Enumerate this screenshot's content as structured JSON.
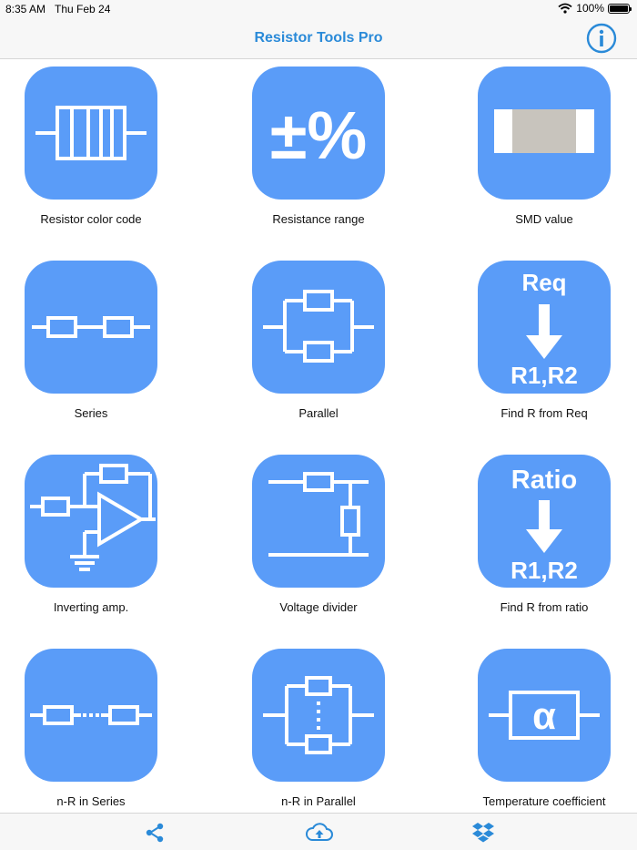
{
  "status": {
    "time": "8:35 AM",
    "date": "Thu Feb 24",
    "battery": "100%"
  },
  "nav": {
    "title": "Resistor Tools Pro",
    "info_icon": "info-icon"
  },
  "tools": [
    {
      "label": "Resistor color code",
      "icon": "resistor-color-code-icon"
    },
    {
      "label": "Resistance range",
      "icon": "plus-minus-percent-icon",
      "glyph": "±%"
    },
    {
      "label": "SMD value",
      "icon": "smd-chip-icon"
    },
    {
      "label": "Series",
      "icon": "series-icon"
    },
    {
      "label": "Parallel",
      "icon": "parallel-icon"
    },
    {
      "label": "Find R from Req",
      "icon": "find-r-from-req-icon",
      "top_text": "Req",
      "bottom_text": "R1,R2"
    },
    {
      "label": "Inverting amp.",
      "icon": "inverting-amp-icon"
    },
    {
      "label": "Voltage divider",
      "icon": "voltage-divider-icon"
    },
    {
      "label": "Find R from ratio",
      "icon": "find-r-from-ratio-icon",
      "top_text": "Ratio",
      "bottom_text": "R1,R2"
    },
    {
      "label": "n-R in Series",
      "icon": "n-r-series-icon"
    },
    {
      "label": "n-R in Parallel",
      "icon": "n-r-parallel-icon"
    },
    {
      "label": "Temperature coefficient",
      "icon": "temperature-coefficient-icon",
      "glyph": "α"
    }
  ],
  "tabbar": {
    "share_icon": "share-icon",
    "upload_icon": "cloud-upload-icon",
    "dropbox_icon": "dropbox-icon"
  },
  "colors": {
    "accent": "#2a8ad8",
    "tile": "#5a9cf8",
    "smd_body": "#c8c4bd"
  }
}
